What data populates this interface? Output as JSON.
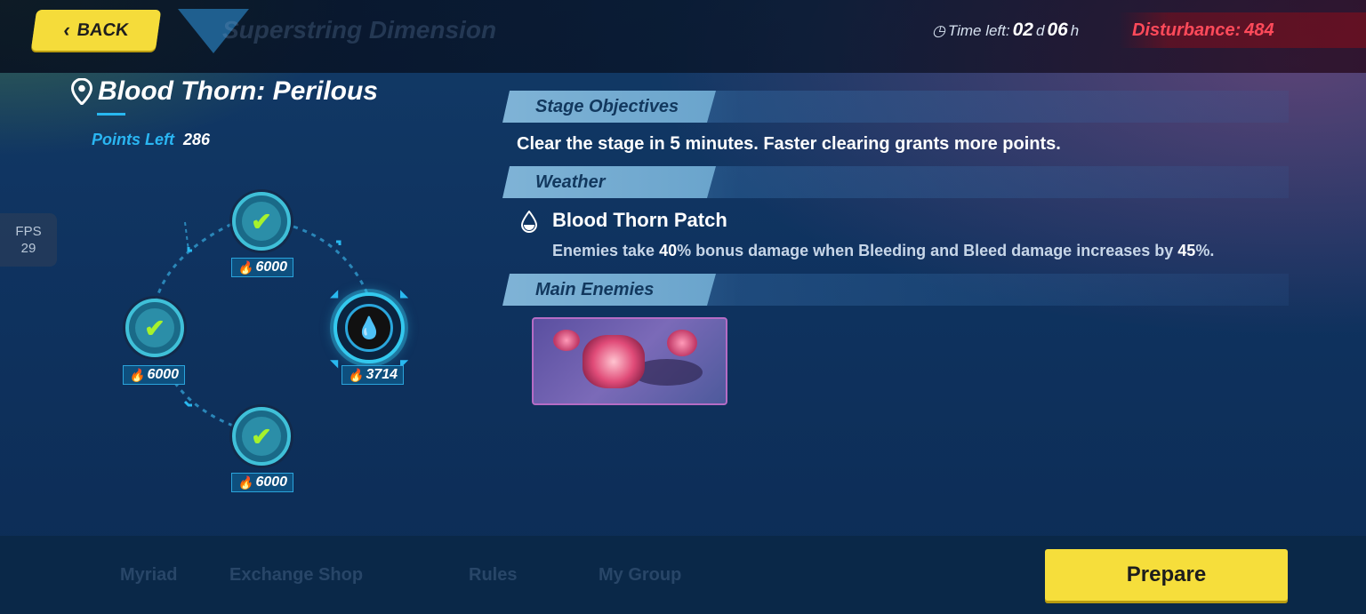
{
  "header": {
    "back_label": "BACK",
    "ghost_title": "Superstring Dimension",
    "time_left_label": "Time left:",
    "time_days": "02",
    "time_days_unit": "d",
    "time_hours": "06",
    "time_hours_unit": "h",
    "disturbance_label": "Disturbance:",
    "disturbance_value": "484"
  },
  "stage": {
    "title": "Blood Thorn: Perilous",
    "points_left_label": "Points Left",
    "points_left_value": "286"
  },
  "fps": {
    "label": "FPS",
    "value": "29"
  },
  "nodes": [
    {
      "state": "cleared",
      "score": "6000"
    },
    {
      "state": "cleared",
      "score": "6000"
    },
    {
      "state": "current",
      "score": "3714"
    },
    {
      "state": "cleared",
      "score": "6000"
    }
  ],
  "objectives": {
    "heading": "Stage Objectives",
    "text_before": "Clear the stage in ",
    "minutes": "5",
    "text_after": " minutes. Faster clearing grants more points."
  },
  "weather": {
    "heading": "Weather",
    "name": "Blood Thorn Patch",
    "desc_1": "Enemies take ",
    "bonus_pct": "40",
    "desc_2": "% bonus damage when Bleeding and Bleed damage increases by ",
    "bleed_pct": "45",
    "desc_3": "%."
  },
  "enemies": {
    "heading": "Main Enemies"
  },
  "bottom": {
    "tabs": [
      "Myriad",
      "Exchange Shop",
      "Rules",
      "My Group"
    ],
    "prepare_label": "Prepare"
  },
  "colors": {
    "accent_yellow": "#f5dc3a",
    "accent_cyan": "#29b9f0",
    "disturbance_red": "#ff4a5a",
    "check_green": "#a6f22c"
  }
}
